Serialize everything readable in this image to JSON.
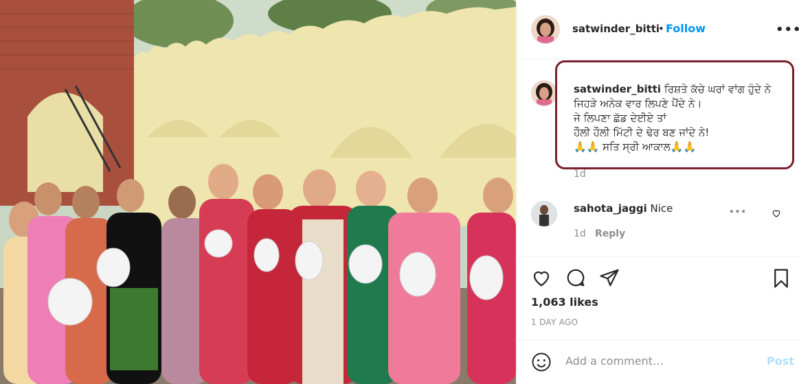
{
  "post": {
    "username": "satwinder_bitti",
    "dot": "•",
    "follow_label": "Follow",
    "more_label": "•••",
    "caption": {
      "username": "satwinder_bitti",
      "lines": [
        "ਰਿਸ਼ਤੇ ਕੱਚੇ ਘਰਾਂ ਵਾਂਗ ਹੁੰਦੇ ਨੇ",
        "ਜਿਹੜੇ ਅਨੇਕ ਵਾਰ ਲਿਪਣੇ ਪੈਂਦੇ ਨੇ।",
        "ਜੇ ਲਿਪਣਾ ਛੱਡ ਦੇਈਏ ਤਾਂ",
        "ਹੌਲੀ ਹੌਲੀ ਮਿੱਟੀ ਦੇ ਢੇਰ ਬਣ ਜਾਂਦੇ ਨੇ!",
        "🙏🙏 ਸਤਿ ਸ੍ਰੀ ਆਕਾਲ🙏🙏"
      ],
      "time": "1d"
    },
    "comments": [
      {
        "username": "sahota_jaggi",
        "text": "Nice",
        "time": "1d",
        "reply_label": "Reply",
        "more_label": "•••"
      }
    ],
    "likes": "1,063 likes",
    "posted_ago": "1 DAY AGO",
    "add_comment_placeholder": "Add a comment…",
    "post_label": "Post"
  },
  "icons": {
    "like": "heart-icon",
    "comment": "comment-icon",
    "share": "share-icon",
    "save": "bookmark-icon",
    "emoji": "emoji-icon",
    "comment_like": "small-heart-icon"
  },
  "colors": {
    "follow": "#0095f6",
    "highlight_box": "#7a1f2b",
    "post_disabled": "#b2dffc",
    "muted": "#8e8e8e"
  }
}
